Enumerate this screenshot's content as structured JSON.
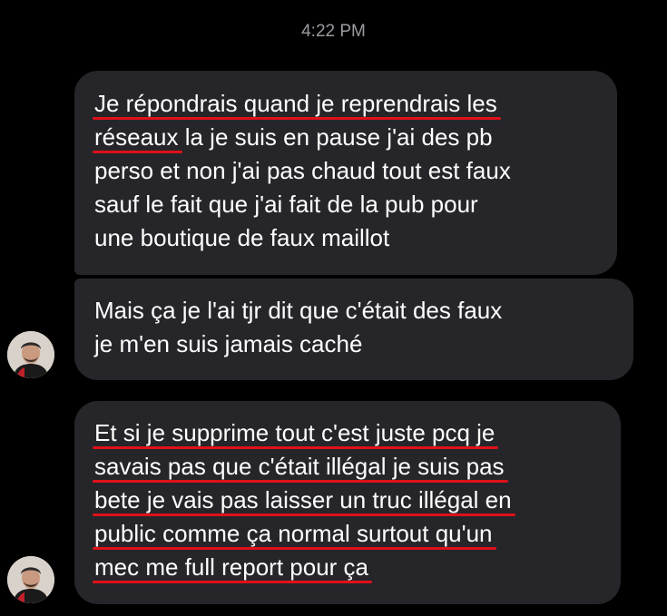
{
  "timestamp": "4:22 PM",
  "messages": [
    {
      "lines": [
        "Je répondrais quand je reprendrais les",
        "réseaux la je suis en pause j'ai des pb",
        "perso et non j'ai pas chaud tout est faux",
        "sauf le fait que j'ai fait de la pub pour",
        "une boutique de faux maillot"
      ],
      "line2_underlined": "réseaux",
      "line2_rest": " la je suis en pause j'ai des pb"
    },
    {
      "lines": [
        "Mais ça je l'ai tjr dit que c'était des faux",
        "je m'en suis jamais caché"
      ]
    },
    {
      "lines": [
        "Et si je supprime tout c'est juste pcq je",
        "savais pas que c'était illégal je suis pas",
        "bete je vais pas laisser un truc illégal en",
        "public comme ça normal surtout qu'un",
        "mec me full report pour ça"
      ]
    }
  ],
  "colors": {
    "background": "#000000",
    "bubble": "#26262a",
    "text": "#ffffff",
    "timestamp": "#9a9aa0",
    "underline": "#e0101a"
  }
}
